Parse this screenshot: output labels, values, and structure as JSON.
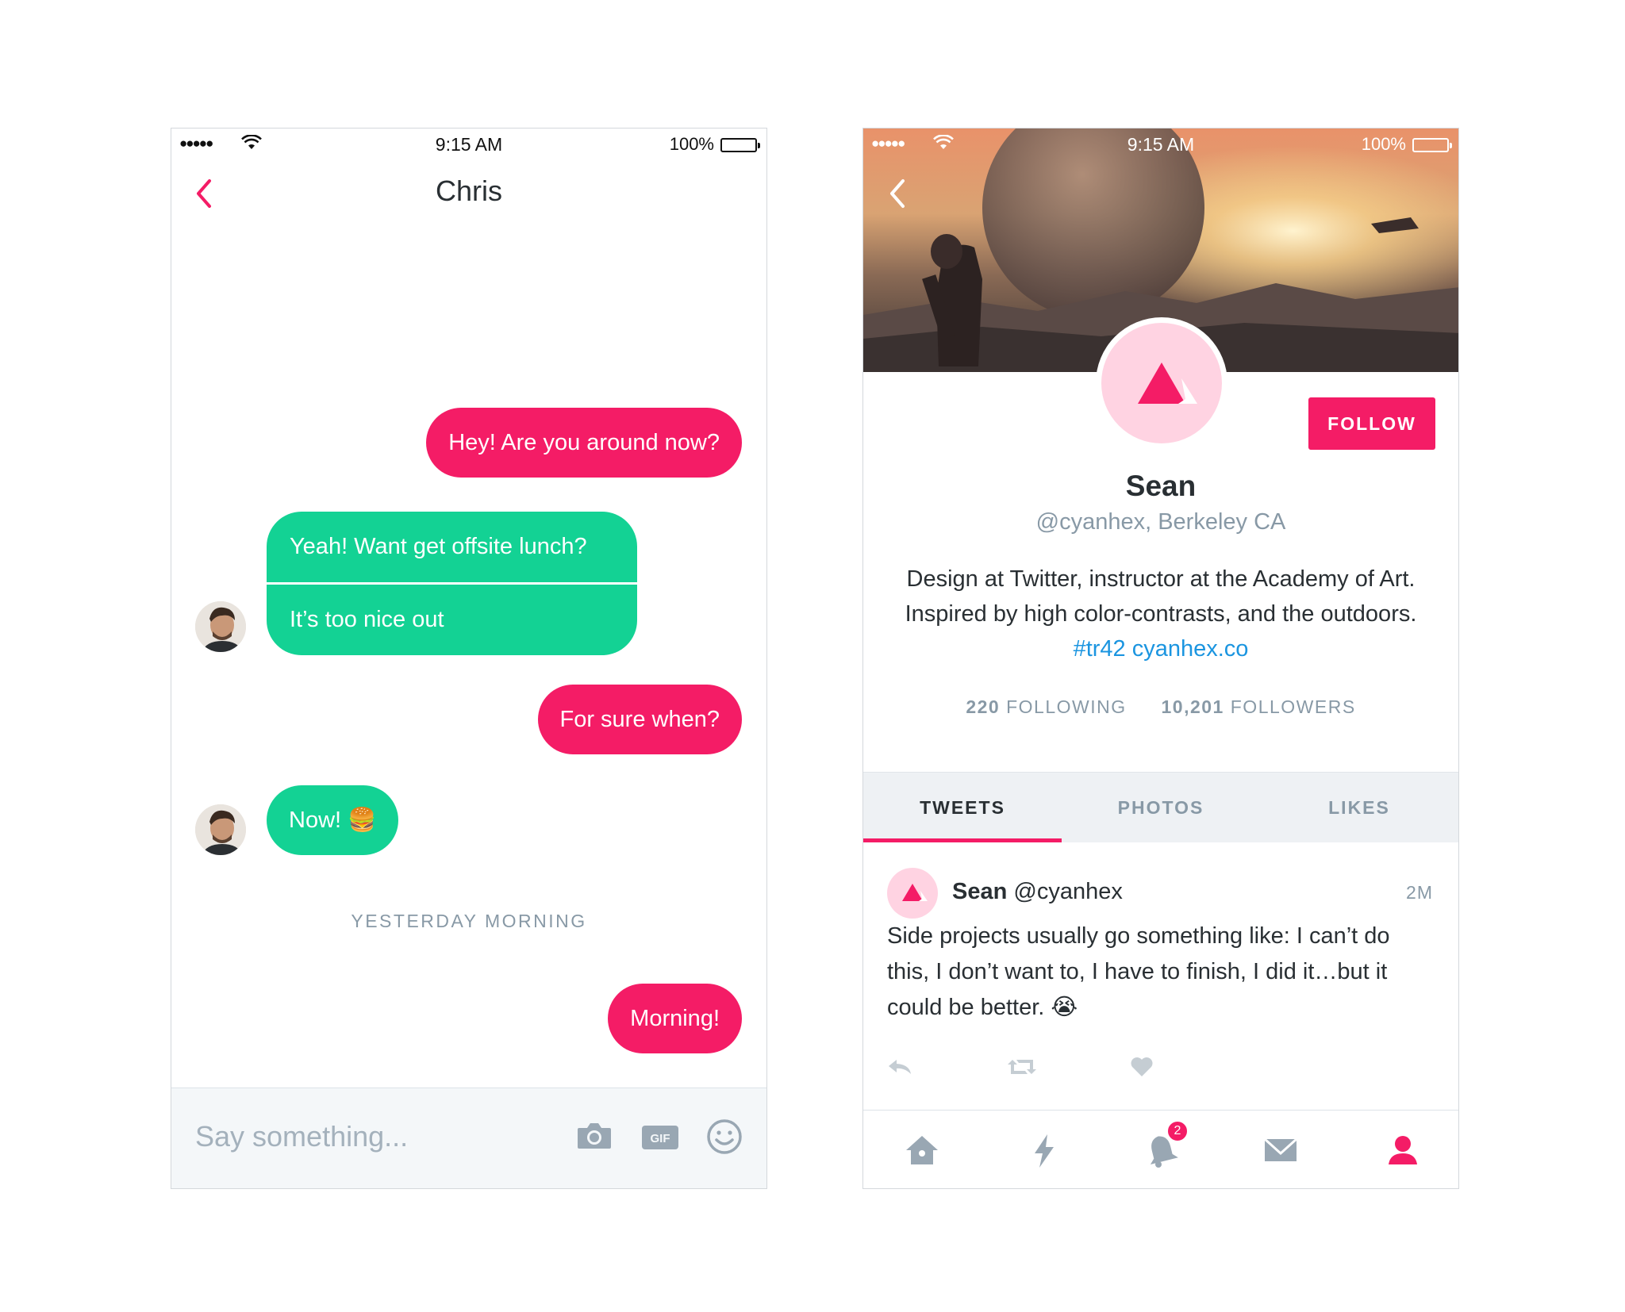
{
  "chat": {
    "status": {
      "time": "9:15 AM",
      "battery": "100%"
    },
    "title": "Chris",
    "messages": {
      "m1": "Hey! Are you around now?",
      "m2a": "Yeah! Want get offsite lunch?",
      "m2b": "It’s too nice out",
      "m3": "For sure when?",
      "m4": "Now! 🍔",
      "m5": "Morning!"
    },
    "divider": "YESTERDAY MORNING",
    "composer": {
      "placeholder": "Say something..."
    },
    "icons": [
      "back-chevron-icon",
      "camera-icon",
      "gif-icon",
      "emoji-icon"
    ]
  },
  "profile": {
    "status": {
      "time": "9:15 AM",
      "battery": "100%"
    },
    "name": "Sean",
    "handle_location": "@cyanhex, Berkeley CA",
    "follow_label": "FOLLOW",
    "bio": {
      "text": "Design at Twitter, instructor at the Academy of Art. Inspired by high color-contrasts, and the outdoors.",
      "hashtag": "#tr42",
      "link": "cyanhex.co"
    },
    "stats": {
      "following_count": "220",
      "following_label": "FOLLOWING",
      "followers_count": "10,201",
      "followers_label": "FOLLOWERS"
    },
    "tabs": [
      "TWEETS",
      "PHOTOS",
      "LIKES"
    ],
    "tweet": {
      "name": "Sean",
      "handle": "@cyanhex",
      "time": "2M",
      "text": "Side projects usually go something like: I can’t do this, I don’t want to, I have to finish, I did it…but it could be better. 😭"
    },
    "tabbar": {
      "notification_badge": "2"
    },
    "colors": {
      "accent": "#f41c66",
      "green": "#13d294",
      "link": "#1b95e0",
      "muted": "#8899a6"
    }
  }
}
